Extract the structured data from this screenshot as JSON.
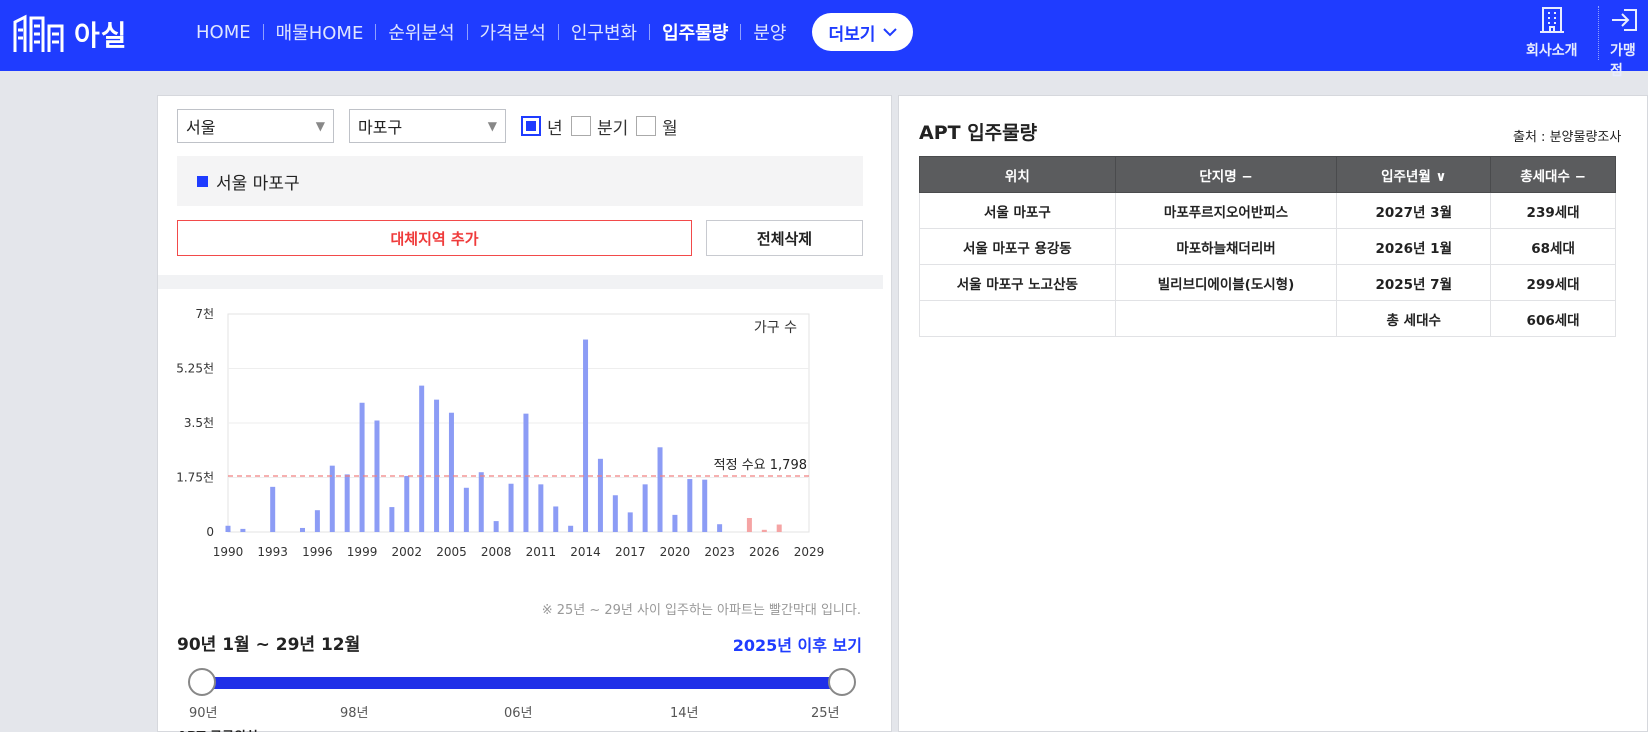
{
  "header": {
    "logo_text": "아실",
    "nav": [
      {
        "label": "HOME",
        "active": false
      },
      {
        "label": "매물HOME",
        "active": false
      },
      {
        "label": "순위분석",
        "active": false
      },
      {
        "label": "가격분석",
        "active": false
      },
      {
        "label": "인구변화",
        "active": false
      },
      {
        "label": "입주물량",
        "active": true
      },
      {
        "label": "분양",
        "active": false
      }
    ],
    "more_label": "더보기",
    "company_label": "회사소개",
    "partner_label": "가맹점"
  },
  "filters": {
    "city": "서울",
    "district": "마포구",
    "periods": [
      {
        "label": "년",
        "checked": true
      },
      {
        "label": "분기",
        "checked": false
      },
      {
        "label": "월",
        "checked": false
      }
    ]
  },
  "region_tag": "서울 마포구",
  "buttons": {
    "add": "대체지역 추가",
    "delete": "전체삭제"
  },
  "chart_data": {
    "type": "bar",
    "legend_label": "가구 수",
    "y_ticks": [
      "0",
      "1.75천",
      "3.5천",
      "5.25천",
      "7천"
    ],
    "x_ticks": [
      "1990",
      "1993",
      "1996",
      "1999",
      "2002",
      "2005",
      "2008",
      "2011",
      "2014",
      "2017",
      "2020",
      "2023",
      "2026",
      "2029"
    ],
    "ylim": [
      0,
      7000
    ],
    "xlim": [
      1990,
      2029
    ],
    "reference_line": {
      "label": "적정 수요 1,798",
      "value": 1798
    },
    "series": [
      {
        "color": "#8c9cf5",
        "points": [
          [
            1990,
            200
          ],
          [
            1991,
            100
          ],
          [
            1993,
            1450
          ],
          [
            1995,
            130
          ],
          [
            1996,
            700
          ],
          [
            1997,
            2130
          ],
          [
            1998,
            1850
          ],
          [
            1999,
            4150
          ],
          [
            2000,
            3580
          ],
          [
            2001,
            800
          ],
          [
            2002,
            1800
          ],
          [
            2003,
            4700
          ],
          [
            2004,
            4250
          ],
          [
            2005,
            3830
          ],
          [
            2006,
            1420
          ],
          [
            2007,
            1920
          ],
          [
            2008,
            350
          ],
          [
            2009,
            1550
          ],
          [
            2010,
            3800
          ],
          [
            2011,
            1530
          ],
          [
            2012,
            820
          ],
          [
            2013,
            200
          ],
          [
            2014,
            6180
          ],
          [
            2015,
            2350
          ],
          [
            2016,
            1180
          ],
          [
            2017,
            630
          ],
          [
            2018,
            1530
          ],
          [
            2019,
            2720
          ],
          [
            2020,
            550
          ],
          [
            2021,
            1700
          ],
          [
            2022,
            1680
          ],
          [
            2023,
            250
          ]
        ]
      },
      {
        "color": "#f5a4a4",
        "points": [
          [
            2025,
            450
          ],
          [
            2026,
            70
          ],
          [
            2027,
            240
          ]
        ]
      }
    ]
  },
  "note": "※ 25년 ~ 29년 사이 입주하는 아파트는 빨간막대 입니다.",
  "range": {
    "label": "90년 1월 ~ 29년 12월",
    "link": "2025년 이후 보기",
    "ticks": [
      "90년",
      "98년",
      "06년",
      "14년",
      "25년"
    ]
  },
  "bottom_heading": "APT 공급위치",
  "table": {
    "title": "APT 입주물량",
    "source": "출처 : 분양물량조사",
    "headers": [
      "위치",
      "단지명 −",
      "입주년월 ∨",
      "총세대수 −"
    ],
    "rows": [
      [
        "서울 마포구",
        "마포푸르지오어반피스",
        "2027년 3월",
        "239세대"
      ],
      [
        "서울 마포구 용강동",
        "마포하늘채더리버",
        "2026년 1월",
        "68세대"
      ],
      [
        "서울 마포구 노고산동",
        "빌리브디에이블(도시형)",
        "2025년 7월",
        "299세대"
      ],
      [
        "",
        "",
        "총 세대수",
        "606세대"
      ]
    ]
  }
}
